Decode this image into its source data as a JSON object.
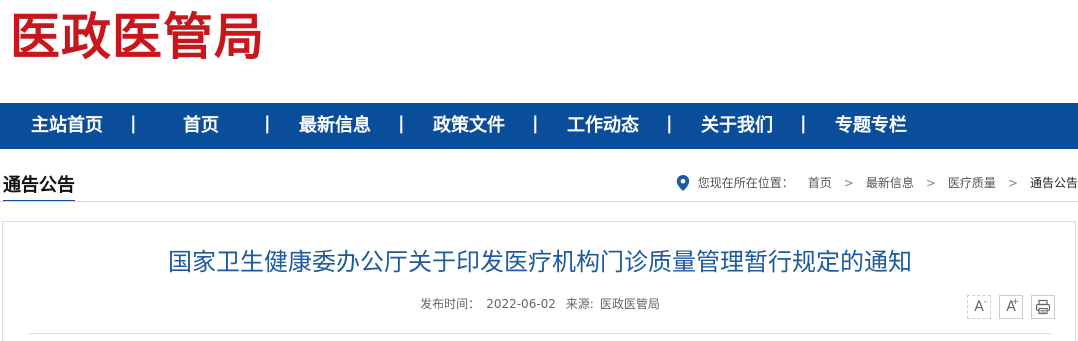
{
  "site": {
    "logo_text": "医政医管局",
    "logo_color": "#c8161d",
    "nav_color": "#0a4d9b"
  },
  "nav": {
    "items": [
      {
        "label": "主站首页"
      },
      {
        "label": "首页"
      },
      {
        "label": "最新信息"
      },
      {
        "label": "政策文件"
      },
      {
        "label": "工作动态"
      },
      {
        "label": "关于我们"
      },
      {
        "label": "专题专栏"
      }
    ],
    "separator": "|"
  },
  "section": {
    "title": "通告公告"
  },
  "breadcrumb": {
    "icon": "location-pin-icon",
    "prefix": "您现在所在位置：",
    "items": [
      "首页",
      "最新信息",
      "医疗质量",
      "通告公告"
    ],
    "separator": ">"
  },
  "article": {
    "title": "国家卫生健康委办公厅关于印发医疗机构门诊质量管理暂行规定的通知",
    "publish_label": "发布时间：",
    "publish_date": "2022-06-02",
    "source_label": "来源:",
    "source": "医政医管局"
  },
  "tools": {
    "font_decrease": "A",
    "font_decrease_mark": "-",
    "font_increase": "A",
    "font_increase_mark": "+",
    "print_icon": "printer-icon"
  }
}
